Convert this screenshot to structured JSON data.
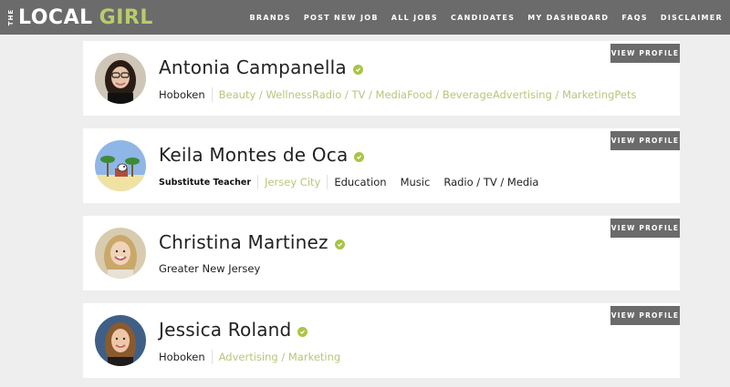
{
  "header": {
    "logo_the": "THE",
    "logo_local": "LOCAL",
    "logo_girl": "GIRL",
    "nav": [
      "BRANDS",
      "POST NEW JOB",
      "ALL JOBS",
      "CANDIDATES",
      "MY DASHBOARD",
      "FAQS",
      "DISCLAIMER"
    ]
  },
  "candidates": [
    {
      "name": "Antonia Campanella",
      "location": "Hoboken",
      "tags": "Beauty / WellnessRadio / TV / MediaFood / BeverageAdvertising / MarketingPets",
      "button": "VIEW PROFILE"
    },
    {
      "name": "Keila Montes de Oca",
      "role": "Substitute Teacher",
      "location": "Jersey City",
      "plain_tags": [
        "Education",
        "Music",
        "Radio / TV / Media"
      ],
      "button": "VIEW PROFILE"
    },
    {
      "name": "Christina Martinez",
      "location": "Greater New Jersey",
      "button": "VIEW PROFILE"
    },
    {
      "name": "Jessica Roland",
      "location": "Hoboken",
      "tags": "Advertising / Marketing",
      "button": "VIEW PROFILE"
    }
  ],
  "colors": {
    "topbar": "#6b6b6b",
    "accent": "#b8cc6a",
    "verified": "#a9c447",
    "button": "#6b6b6b"
  },
  "icons": {
    "verified": "verified-check-icon"
  }
}
